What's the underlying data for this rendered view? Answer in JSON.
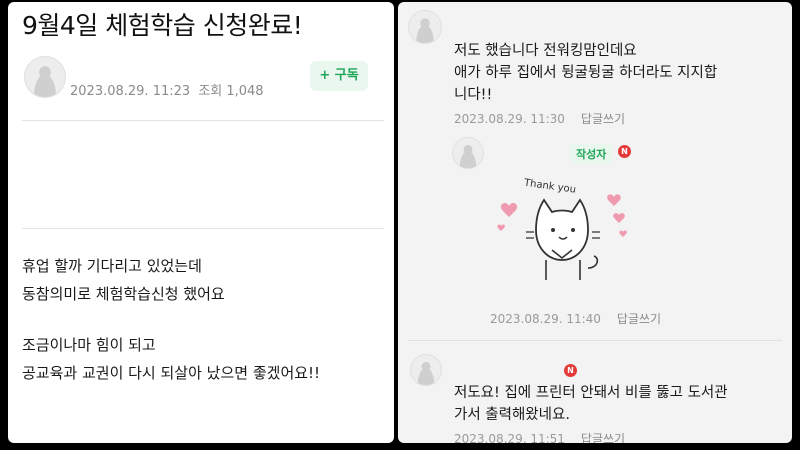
{
  "post": {
    "title": "9월4일 체험학습 신청완료!",
    "date": "2023.08.29. 11:23",
    "views": "조회 1,048",
    "subscribe_label": "+ 구독",
    "body": [
      "휴업 할까 기다리고 있었는데",
      "동참의미로 체험학습신청 했어요",
      "조금이나마 힘이 되고",
      "공교육과 교권이 다시 되살아 났으면 좋겠어요!!"
    ]
  },
  "comments": [
    {
      "lines": [
        "저도 했습니다 전워킹맘인데요",
        "애가 하루 집에서 뒹굴뒹굴 하더라도 지지합",
        "니다!!"
      ],
      "date": "2023.08.29. 11:30",
      "reply": "답글쓰기"
    },
    {
      "writer_badge": "작성자",
      "new_badge": "N",
      "sticker_text": "Thank you",
      "date": "2023.08.29. 11:40",
      "reply": "답글쓰기"
    },
    {
      "new_badge": "N",
      "lines": [
        "저도요! 집에 프린터 안돼서 비를 뚫고 도서관",
        "가서 출력해왔네요."
      ],
      "date": "2023.08.29. 11:51",
      "reply": "답글쓰기"
    }
  ],
  "colors": {
    "accent": "#1fa659",
    "badge_new": "#e33a3a"
  }
}
